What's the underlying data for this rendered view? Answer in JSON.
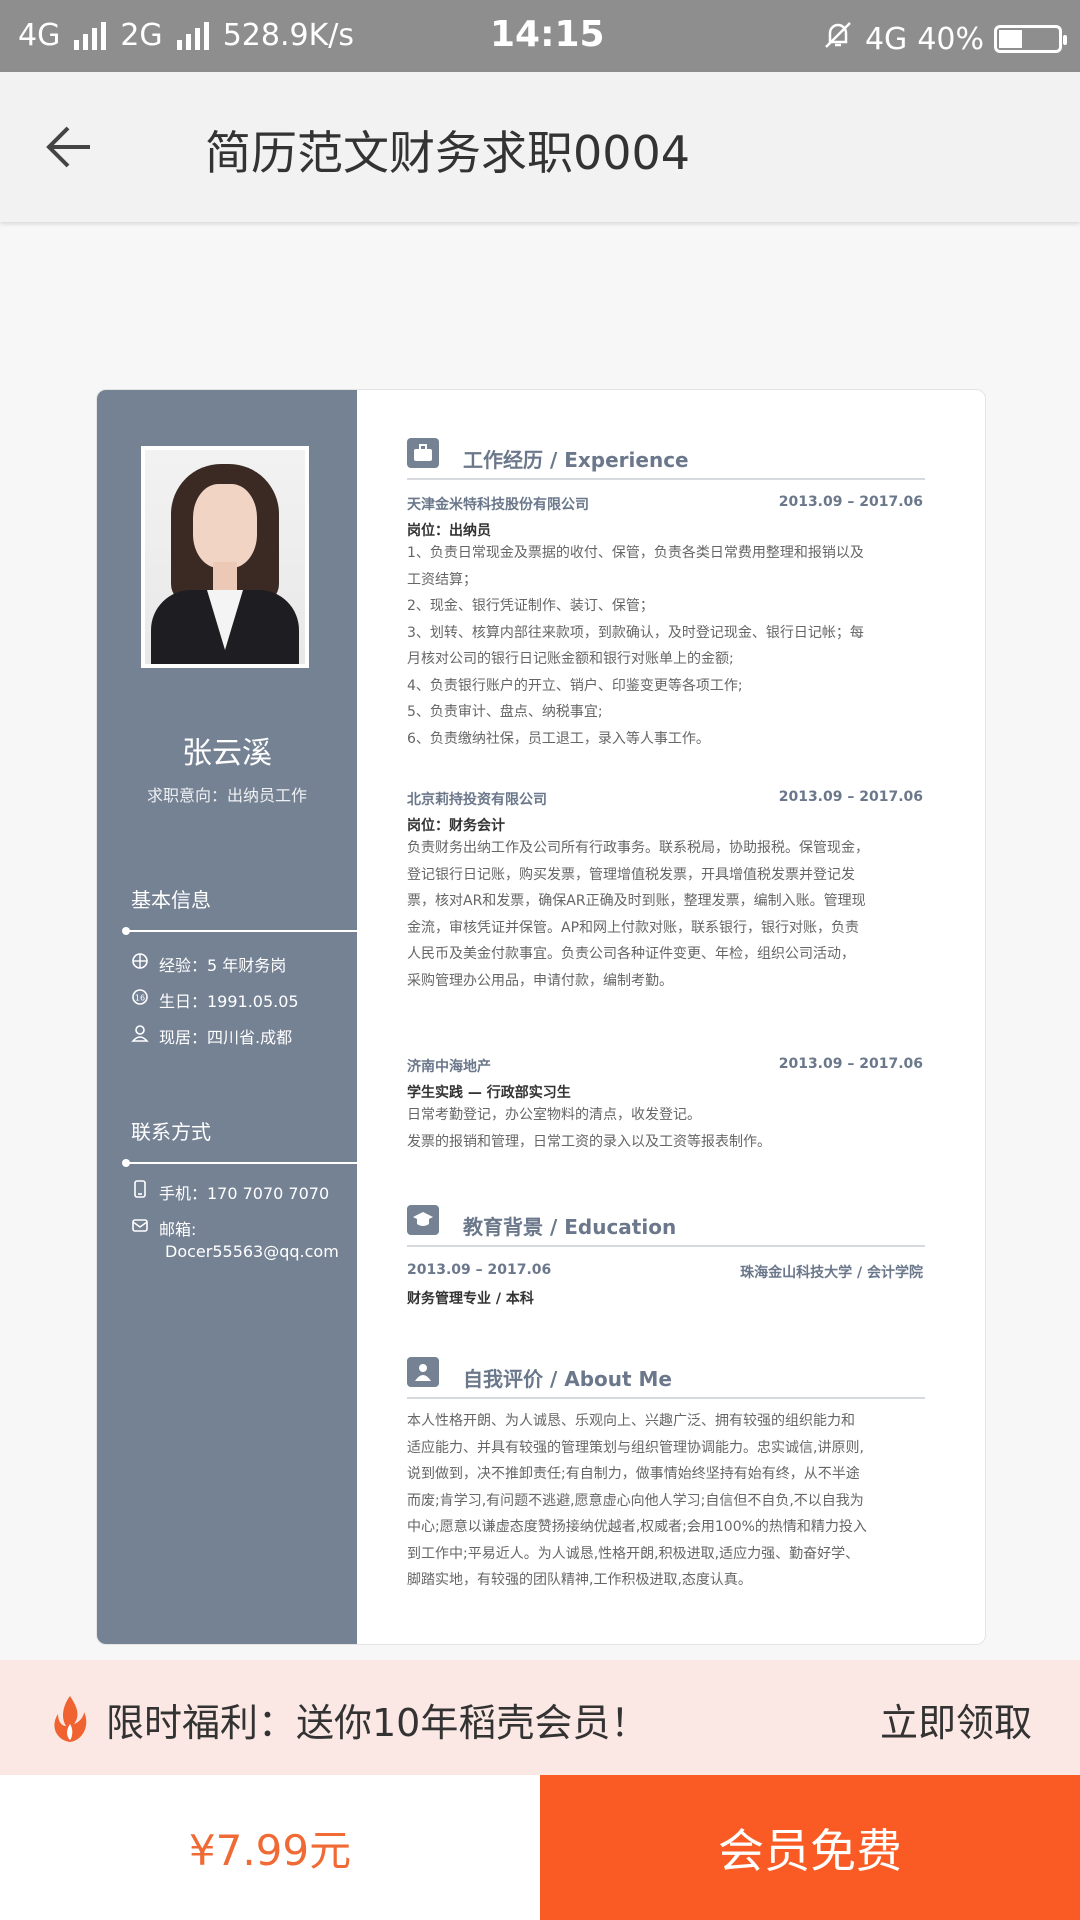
{
  "status": {
    "net1": "4G",
    "net2": "2G",
    "speed": "528.9K/s",
    "time": "14:15",
    "net3": "4G",
    "battery": "40%",
    "battery_level": 0.4
  },
  "header": {
    "title": "简历范文财务求职0004"
  },
  "resume": {
    "name": "张云溪",
    "intent": "求职意向：出纳员工作",
    "basic_title": "基本信息",
    "experience_line": "经验：5 年财务岗",
    "birthday": "生日：1991.05.05",
    "residence": "现居：四川省.成都",
    "contact_title": "联系方式",
    "phone": "手机：170 7070 7070",
    "email_label": "邮箱:",
    "email": "Docer55563@qq.com",
    "exp_heading": "工作经历 / Experience",
    "jobs": [
      {
        "company": "天津金米特科技股份有限公司",
        "date": "2013.09 – 2017.06",
        "position": "岗位：出纳员",
        "lines": [
          "1、负责日常现金及票据的收付、保管，负责各类日常费用整理和报销以及",
          "工资结算；",
          "2、现金、银行凭证制作、装订、保管；",
          "3、划转、核算内部往来款项，到款确认，及时登记现金、银行日记帐；每",
          "月核对公司的银行日记账金额和银行对账单上的金额;",
          "4、负责银行账户的开立、销户、印鉴变更等各项工作;",
          "5、负责审计、盘点、纳税事宜;",
          "6、负责缴纳社保，员工退工，录入等人事工作。"
        ]
      },
      {
        "company": "北京莉持投资有限公司",
        "date": "2013.09 – 2017.06",
        "position": "岗位：财务会计",
        "lines": [
          "负责财务出纳工作及公司所有行政事务。联系税局，协助报税。保管现金，",
          "登记银行日记账，购买发票，管理增值税发票，开具增值税发票并登记发",
          "票，核对AR和发票，确保AR正确及时到账，整理发票，编制入账。管理现",
          "金流，审核凭证并保管。AP和网上付款对账，联系银行，银行对账，负责",
          "人民币及美金付款事宜。负责公司各种证件变更、年检，组织公司活动，",
          "采购管理办公用品，申请付款，编制考勤。"
        ]
      },
      {
        "company": "济南中海地产",
        "date": "2013.09 – 2017.06",
        "position": "学生实践 — 行政部实习生",
        "lines": [
          "日常考勤登记，办公室物料的清点，收发登记。",
          "发票的报销和管理，日常工资的录入以及工资等报表制作。"
        ]
      }
    ],
    "edu_heading": "教育背景 / Education",
    "edu_date": "2013.09 – 2017.06",
    "edu_school": "珠海金山科技大学 / 会计学院",
    "edu_major": "财务管理专业 / 本科",
    "about_heading": "自我评价 / About Me",
    "about_lines": [
      "本人性格开朗、为人诚恳、乐观向上、兴趣广泛、拥有较强的组织能力和",
      "适应能力、并具有较强的管理策划与组织管理协调能力。忠实诚信,讲原则,",
      "说到做到，决不推卸责任;有自制力，做事情始终坚持有始有终，从不半途",
      "而废;肯学习,有问题不逃避,愿意虚心向他人学习;自信但不自负,不以自我为",
      "中心;愿意以谦虚态度赞扬接纳优越者,权威者;会用100%的热情和精力投入",
      "到工作中;平易近人。为人诚恳,性格开朗,积极进取,适应力强、勤奋好学、",
      "脚踏实地，有较强的团队精神,工作积极进取,态度认真。"
    ]
  },
  "promo": {
    "text": "限时福利：送你10年稻壳会员！",
    "action": "立即领取"
  },
  "bottom": {
    "price": "¥7.99元",
    "member_free": "会员免费"
  },
  "colors": {
    "sidebar": "#758294",
    "accent": "#fa5b25",
    "price": "#f06a35"
  }
}
